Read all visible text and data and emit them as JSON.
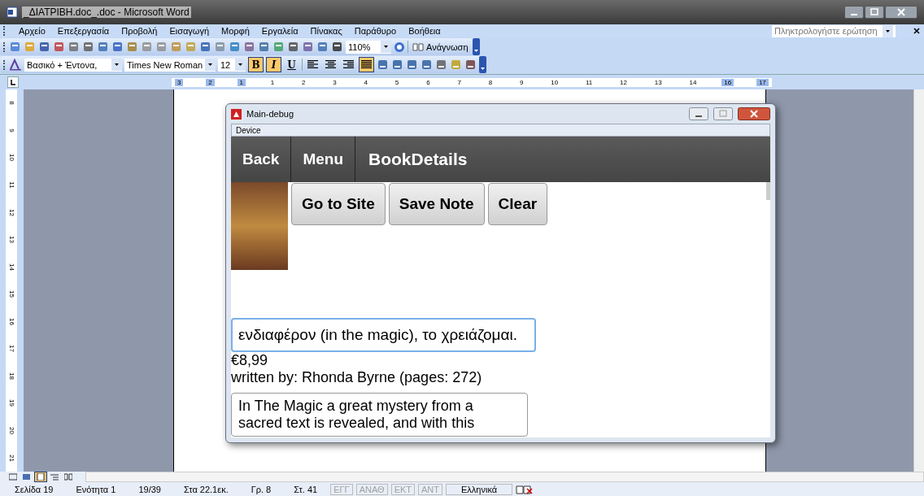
{
  "window": {
    "title": "_ΔΙΑΤΡΙΒΗ.doc_.doc - Microsoft Word"
  },
  "menu": [
    "Αρχείο",
    "Επεξεργασία",
    "Προβολή",
    "Εισαγωγή",
    "Μορφή",
    "Εργαλεία",
    "Πίνακας",
    "Παράθυρο",
    "Βοήθεια"
  ],
  "help_search": {
    "placeholder": "Πληκτρολογήστε ερώτηση"
  },
  "standard_toolbar": {
    "zoom": "110%",
    "reading_button": "Ανάγνωση"
  },
  "formatting_toolbar": {
    "style": "Βασικό + Έντονα,",
    "font": "Times New Roman",
    "size": "12",
    "buttons": [
      {
        "label": "B",
        "kind": "bold",
        "selected": true
      },
      {
        "label": "I",
        "kind": "italic",
        "selected": true
      },
      {
        "label": "U",
        "kind": "underline",
        "selected": false
      }
    ],
    "alignment": [
      {
        "kind": "left",
        "selected": false
      },
      {
        "kind": "center",
        "selected": false
      },
      {
        "kind": "right",
        "selected": false
      },
      {
        "kind": "justify",
        "selected": true
      }
    ]
  },
  "horizontal_ruler": [
    "3",
    "2",
    "1",
    "1",
    "2",
    "3",
    "4",
    "5",
    "6",
    "7",
    "8",
    "9",
    "10",
    "11",
    "12",
    "13",
    "14",
    "16",
    "17"
  ],
  "vertical_ruler": [
    "8",
    "9",
    "10",
    "11",
    "12",
    "13",
    "14",
    "15",
    "16",
    "17",
    "18",
    "19",
    "20",
    "21"
  ],
  "view_buttons": [
    {
      "kind": "normal",
      "selected": false
    },
    {
      "kind": "web",
      "selected": false
    },
    {
      "kind": "print",
      "selected": true
    },
    {
      "kind": "outline",
      "selected": false
    },
    {
      "kind": "reading",
      "selected": false
    }
  ],
  "status_bar": {
    "fields": [
      "Σελίδα 19",
      "Ενότητα 1",
      "19/39",
      "Στα 22.1εκ.",
      "Γρ. 8",
      "Στ. 41"
    ],
    "modes": [
      {
        "label": "ΕΓΓ",
        "on": false
      },
      {
        "label": "ΑΝΑΘ",
        "on": false
      },
      {
        "label": "ΕΚΤ",
        "on": false
      },
      {
        "label": "ΑΝΤ",
        "on": false
      }
    ],
    "language": "Ελληνικά"
  },
  "app_window": {
    "title": "Main-debug",
    "menu": [
      "Device"
    ],
    "nav": {
      "back": "Back",
      "menu": "Menu",
      "title": "BookDetails"
    },
    "buttons": [
      "Go to Site",
      "Save Note",
      "Clear"
    ],
    "note": {
      "value": "ενδιαφέρον (in the magic), το χρειάζομαι."
    },
    "price": "€8,99",
    "author_line": "written by: Rhonda Byrne (pages: 272)",
    "description": "In The Magic a great mystery from a sacred text is revealed, and with this"
  }
}
